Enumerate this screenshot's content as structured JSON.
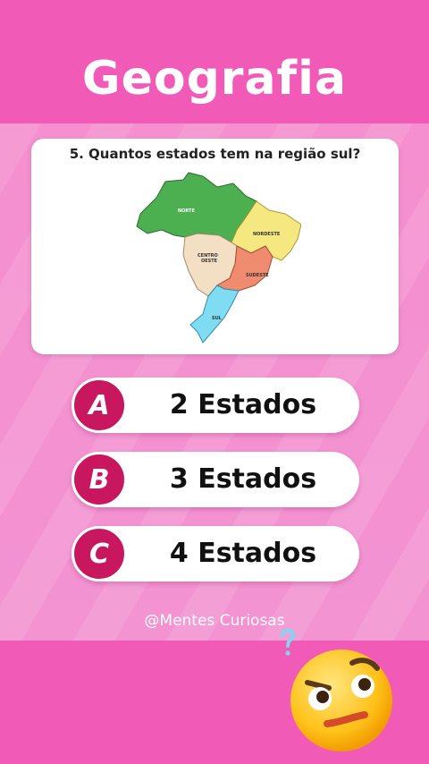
{
  "header": {
    "title": "Geografia"
  },
  "question": {
    "text": "5. Quantos estados tem na região sul?",
    "map_labels": {
      "north": "NORTE",
      "northeast": "NORDESTE",
      "center_west_1": "CENTRO",
      "center_west_2": "OESTE",
      "southeast": "SUDESTE",
      "south": "SUL"
    }
  },
  "options": [
    {
      "letter": "A",
      "label": "2 Estados"
    },
    {
      "letter": "B",
      "label": "3 Estados"
    },
    {
      "letter": "C",
      "label": "4 Estados"
    }
  ],
  "footer": {
    "handle": "@Mentes Curiosas"
  },
  "colors": {
    "background": "#f06fbe",
    "band": "#f25ab8",
    "badge": "#c8175f",
    "north": "#4caf50",
    "northeast": "#f5e880",
    "center_west": "#f2dfc4",
    "southeast": "#ef8c6f",
    "south": "#7fdcf2"
  },
  "icons": {
    "thinking_emoji": "thinking-face-icon",
    "question_mark": "question-mark-icon"
  }
}
